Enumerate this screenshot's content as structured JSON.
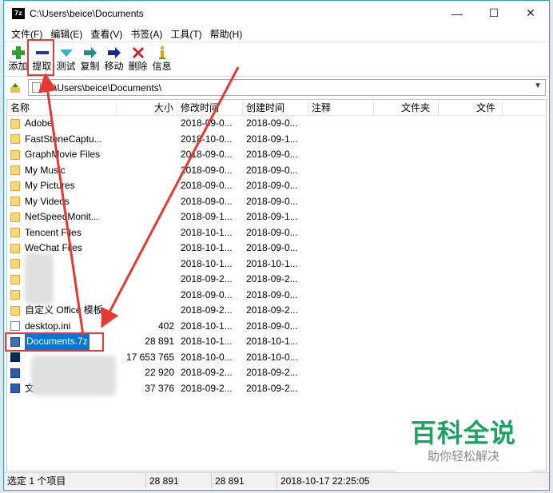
{
  "window": {
    "title": "C:\\Users\\beice\\Documents",
    "app_icon_text": "7z",
    "minimize_glyph": "—",
    "maximize_glyph": "☐",
    "close_glyph": "✕"
  },
  "menu": [
    "文件(F)",
    "编辑(E)",
    "查看(V)",
    "书签(A)",
    "工具(T)",
    "帮助(H)"
  ],
  "toolbar": [
    {
      "label": "添加",
      "icon": "add-icon",
      "color": "#2e9e2e"
    },
    {
      "label": "提取",
      "icon": "extract-icon",
      "color": "#1a3a9a"
    },
    {
      "label": "测试",
      "icon": "test-icon",
      "color": "#3ab0c8"
    },
    {
      "label": "复制",
      "icon": "copy-icon",
      "color": "#2a8a8a"
    },
    {
      "label": "移动",
      "icon": "move-icon",
      "color": "#1a2a8a"
    },
    {
      "label": "删除",
      "icon": "delete-icon",
      "color": "#d02020"
    },
    {
      "label": "信息",
      "icon": "info-icon",
      "color": "#d8a800"
    }
  ],
  "address": {
    "path": "C:\\Users\\beice\\Documents\\"
  },
  "columns": [
    "名称",
    "大小",
    "修改时间",
    "创建时间",
    "注释",
    "文件夹",
    "文件"
  ],
  "rows": [
    {
      "name": "Adobe",
      "size": "",
      "modified": "2018-09-0...",
      "created": "2018-09-0...",
      "type": "folder"
    },
    {
      "name": "FastStoneCaptu...",
      "size": "",
      "modified": "2018-10-0...",
      "created": "2018-09-1...",
      "type": "folder"
    },
    {
      "name": "GraphMovie Files",
      "size": "",
      "modified": "2018-09-0...",
      "created": "2018-09-0...",
      "type": "folder"
    },
    {
      "name": "My Music",
      "size": "",
      "modified": "2018-09-0...",
      "created": "2018-09-0...",
      "type": "folder"
    },
    {
      "name": "My Pictures",
      "size": "",
      "modified": "2018-09-0...",
      "created": "2018-09-0...",
      "type": "folder"
    },
    {
      "name": "My Videos",
      "size": "",
      "modified": "2018-09-0...",
      "created": "2018-09-0...",
      "type": "folder"
    },
    {
      "name": "NetSpeedMonit...",
      "size": "",
      "modified": "2018-09-1...",
      "created": "2018-09-1...",
      "type": "folder"
    },
    {
      "name": "Tencent Files",
      "size": "",
      "modified": "2018-10-1...",
      "created": "2018-09-0...",
      "type": "folder"
    },
    {
      "name": "WeChat Files",
      "size": "",
      "modified": "2018-10-1...",
      "created": "2018-09-0...",
      "type": "folder"
    },
    {
      "name": "",
      "size": "",
      "modified": "2018-10-1...",
      "created": "2018-10-1...",
      "type": "folder"
    },
    {
      "name": "",
      "size": "",
      "modified": "2018-09-2...",
      "created": "2018-09-2...",
      "type": "folder"
    },
    {
      "name": "",
      "size": "",
      "modified": "2018-09-0...",
      "created": "2018-09-0...",
      "type": "folder"
    },
    {
      "name": "自定义 Office 模板",
      "size": "",
      "modified": "2018-09-2...",
      "created": "2018-09-2...",
      "type": "folder"
    },
    {
      "name": "desktop.ini",
      "size": "402",
      "modified": "2018-10-1...",
      "created": "2018-09-0...",
      "type": "doc"
    },
    {
      "name": "Documents.7z",
      "size": "28 891",
      "modified": "2018-10-1...",
      "created": "2018-10-1...",
      "type": "arch",
      "selected": true
    },
    {
      "name": "",
      "size": "17 653 765",
      "modified": "2018-10-0...",
      "created": "2018-10-0...",
      "type": "ps"
    },
    {
      "name": "",
      "size": "22 920",
      "modified": "2018-09-2...",
      "created": "2018-09-2...",
      "type": "word"
    },
    {
      "name": "文",
      "size": "37 376",
      "modified": "2018-09-2...",
      "created": "2018-09-2...",
      "type": "word"
    }
  ],
  "status": {
    "selection": "选定 1 个项目",
    "size": "28 891",
    "packed": "28 891",
    "datetime": "2018-10-17 22:25:05"
  },
  "watermark": {
    "title": "百科全说",
    "subtitle": "助你轻松解决"
  },
  "colors": {
    "accent": "#0078d7",
    "annotation": "#e53935",
    "watermark": "#1aa260"
  }
}
